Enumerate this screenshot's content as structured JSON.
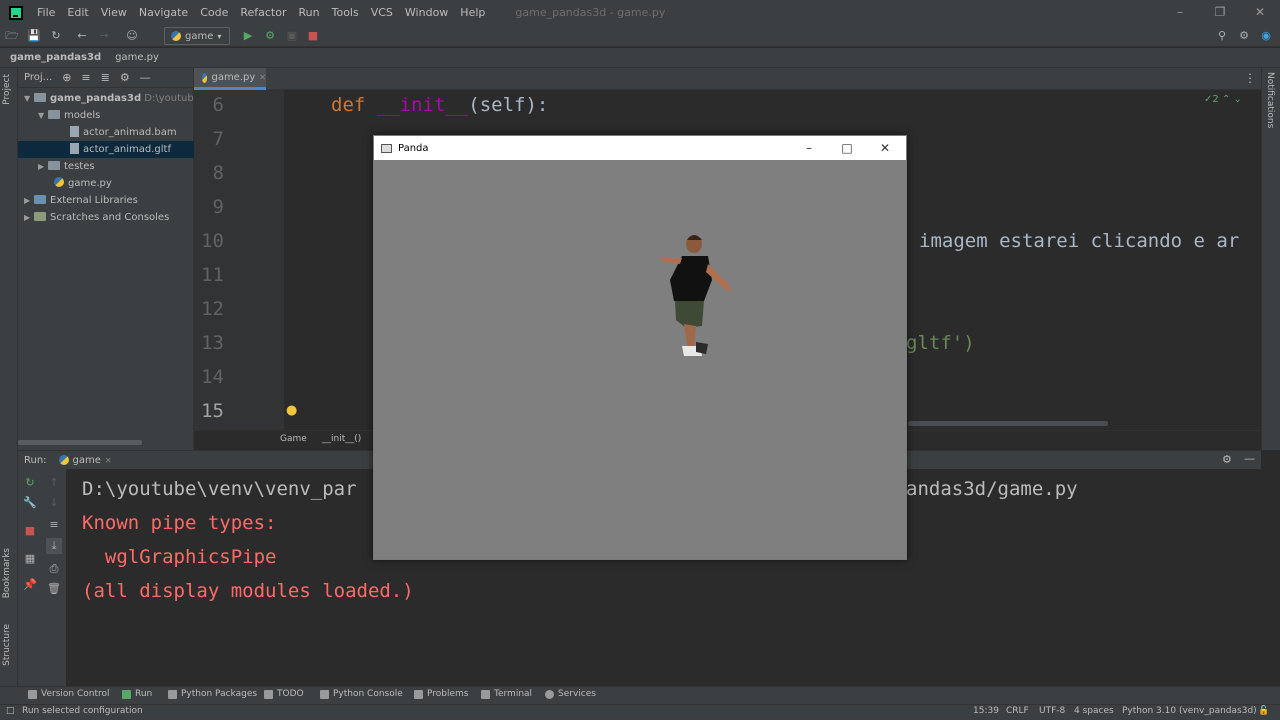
{
  "menubar": {
    "items": [
      "File",
      "Edit",
      "View",
      "Navigate",
      "Code",
      "Refactor",
      "Run",
      "Tools",
      "VCS",
      "Window",
      "Help"
    ],
    "window_title": "game_pandas3d - game.py"
  },
  "toolbar": {
    "run_config": "game"
  },
  "navbar": {
    "project": "game_pandas3d",
    "file": "game.py"
  },
  "project_panel": {
    "title": "Proj...",
    "stripe_label": "Project",
    "tree": [
      {
        "label": "game_pandas3d",
        "suffix": "D:\\youtube\\g",
        "type": "folder"
      },
      {
        "label": "models",
        "type": "folder"
      },
      {
        "label": "actor_animad.bam",
        "type": "file"
      },
      {
        "label": "actor_animad.gltf",
        "type": "file"
      },
      {
        "label": "testes",
        "type": "folder"
      },
      {
        "label": "game.py",
        "type": "file"
      },
      {
        "label": "External Libraries",
        "type": "lib"
      },
      {
        "label": "Scratches and Consoles",
        "type": "scratch"
      }
    ]
  },
  "editor": {
    "tab": "game.py",
    "inspection_count": "2",
    "line_numbers": [
      "6",
      "7",
      "8",
      "9",
      "10",
      "11",
      "12",
      "13",
      "14",
      "15"
    ],
    "def_keyword": "def",
    "init_name": "__init__",
    "init_args": "(self):",
    "line10_comment": "imagem estarei clicando e ar",
    "line13_text": "gltf')",
    "breadcrumb": [
      "Game",
      "__init__()"
    ]
  },
  "run_panel": {
    "label": "Run:",
    "tab": "game",
    "console": [
      "D:\\youtube\\venv\\venv_par",
      "andas3d/game.py",
      "Known pipe types:",
      "  wglGraphicsPipe",
      "(all display modules loaded.)"
    ]
  },
  "left_stripe": {
    "bookmarks": "Bookmarks",
    "structure": "Structure"
  },
  "tool_windows": [
    "Version Control",
    "Run",
    "Python Packages",
    "TODO",
    "Python Console",
    "Problems",
    "Terminal",
    "Services"
  ],
  "status_bar": {
    "message": "Run selected configuration",
    "position": "15:39",
    "line_sep": "CRLF",
    "encoding": "UTF-8",
    "indent": "4 spaces",
    "interpreter": "Python 3.10 (venv_pandas3d)"
  },
  "panda_window": {
    "title": "Panda"
  },
  "right_stripe": {
    "notifications": "Notifications"
  },
  "colors": {
    "ide_bg": "#2b2b2b",
    "panel_bg": "#3c3f41",
    "keyword": "#cc7832",
    "dunder": "#b200b2",
    "string": "#6a8759",
    "error_output": "#ff6b68",
    "canvas_gray": "#7f7f7f"
  }
}
